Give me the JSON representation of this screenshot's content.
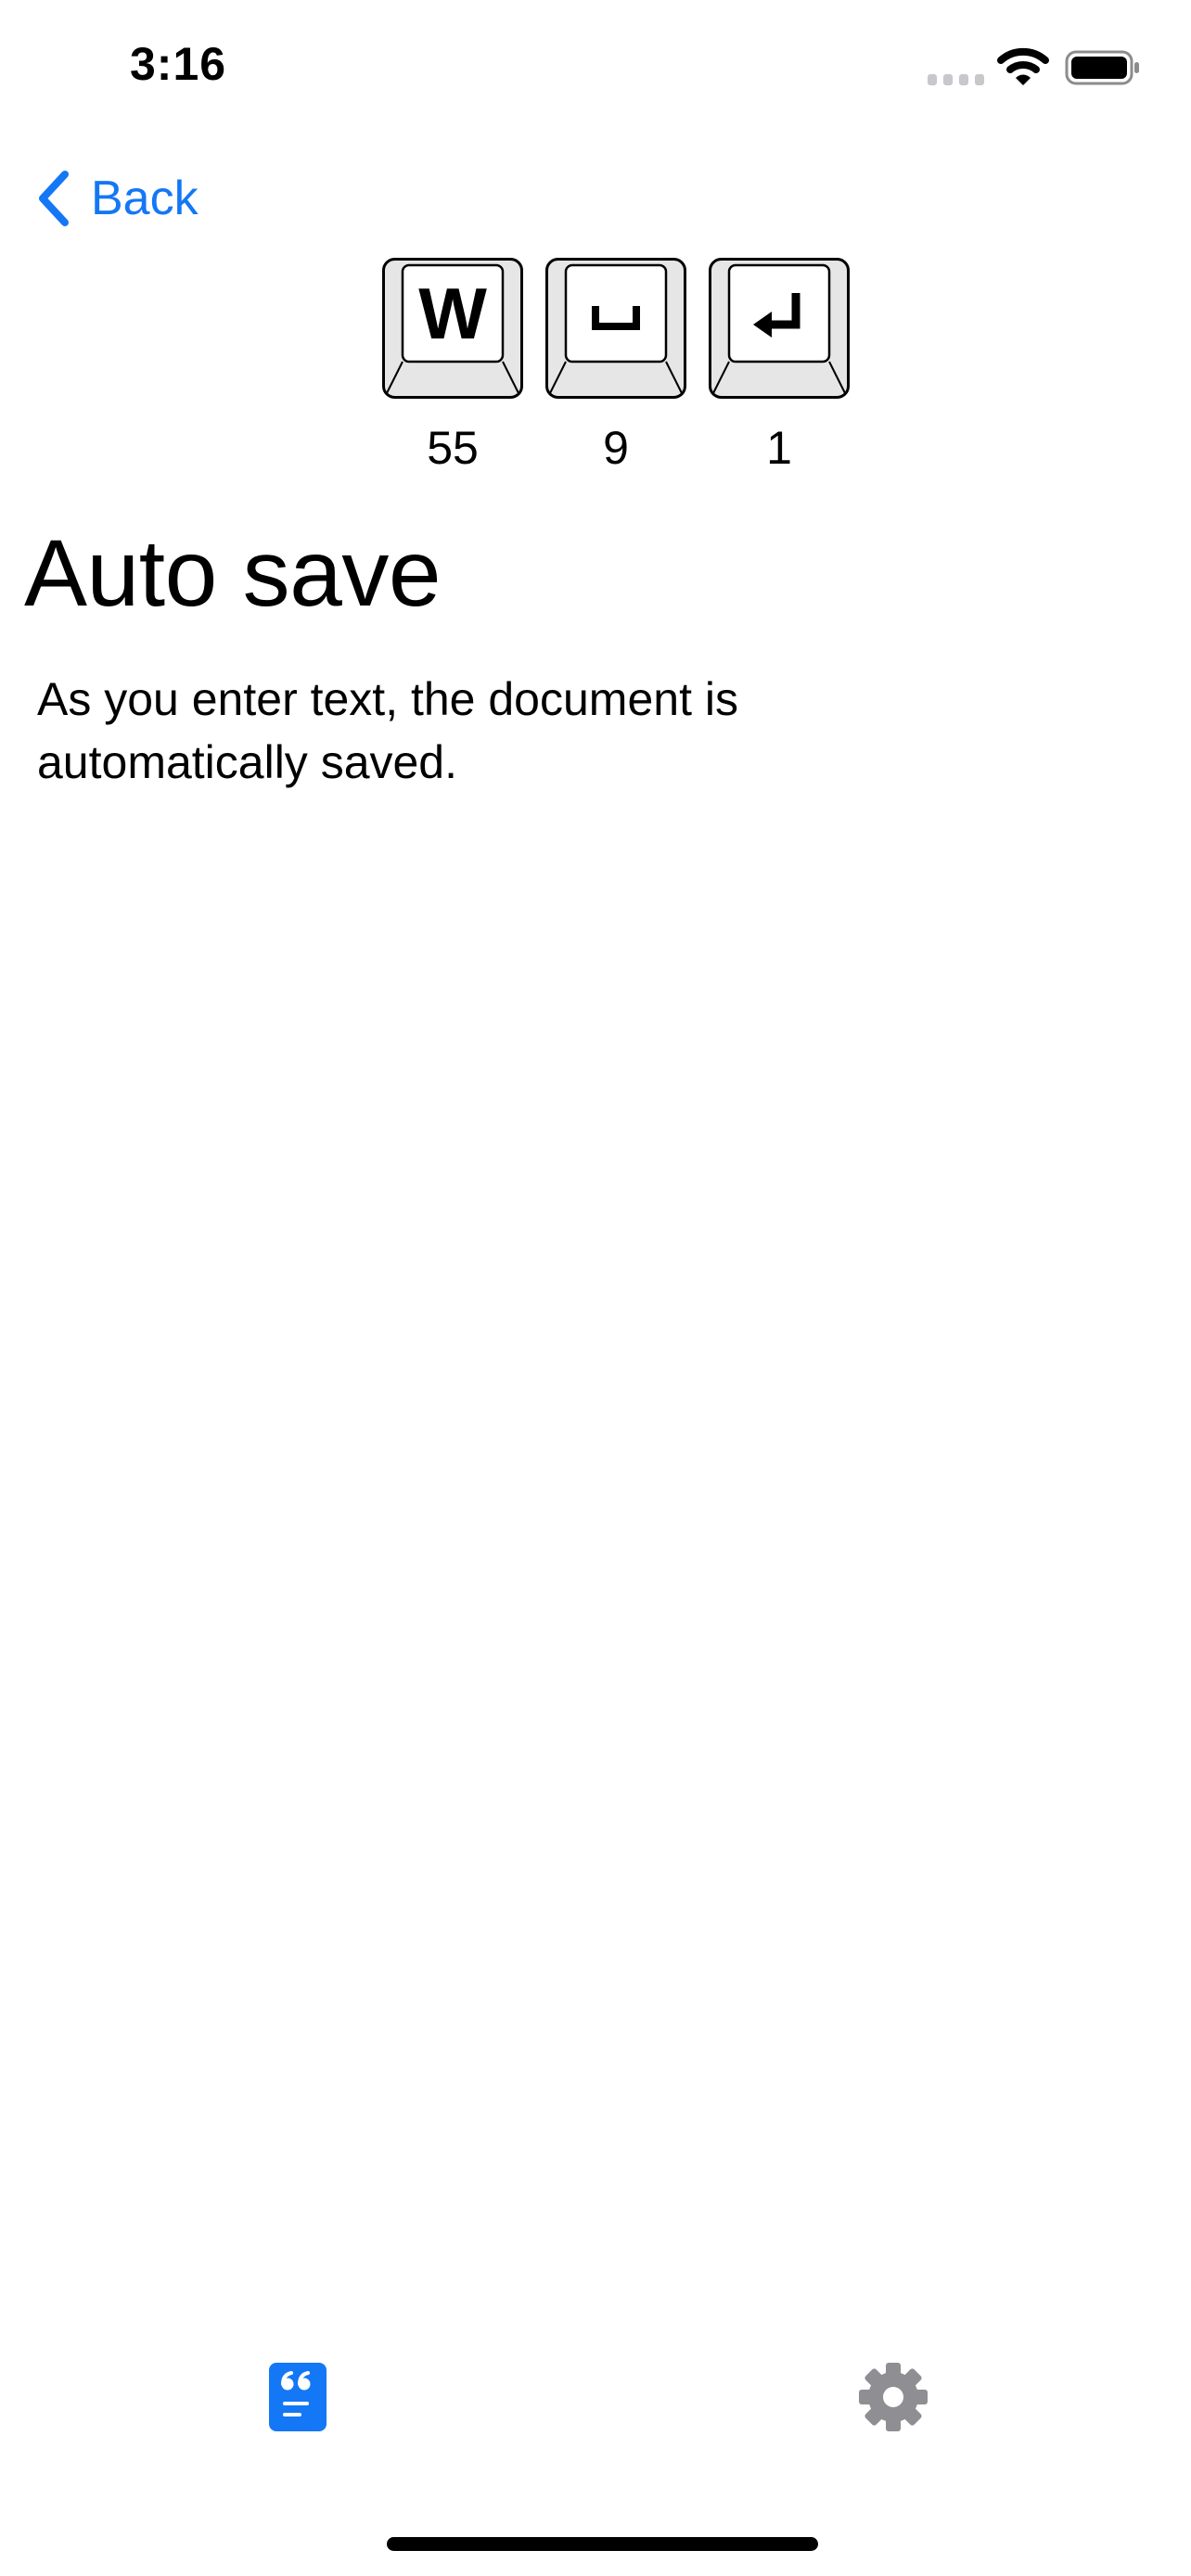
{
  "status_bar": {
    "time": "3:16",
    "icons": [
      "signal-icon",
      "wifi-icon",
      "battery-icon"
    ]
  },
  "nav": {
    "back_label": "Back",
    "back_icon": "chevron-left-icon",
    "accent_color": "#1477f5"
  },
  "key_stats": [
    {
      "key": "W",
      "icon": "letter-key-icon",
      "count": "55"
    },
    {
      "key": "space",
      "icon": "space-key-icon",
      "count": "9"
    },
    {
      "key": "return",
      "icon": "return-key-icon",
      "count": "1"
    }
  ],
  "content": {
    "title": "Auto save",
    "description": "As you enter text, the document is automatically saved."
  },
  "tab_bar": {
    "tabs": [
      {
        "icon": "quote-document-icon",
        "active": true,
        "color": "#1477f5"
      },
      {
        "icon": "gear-icon",
        "active": false,
        "color": "#8e8e93"
      }
    ]
  }
}
